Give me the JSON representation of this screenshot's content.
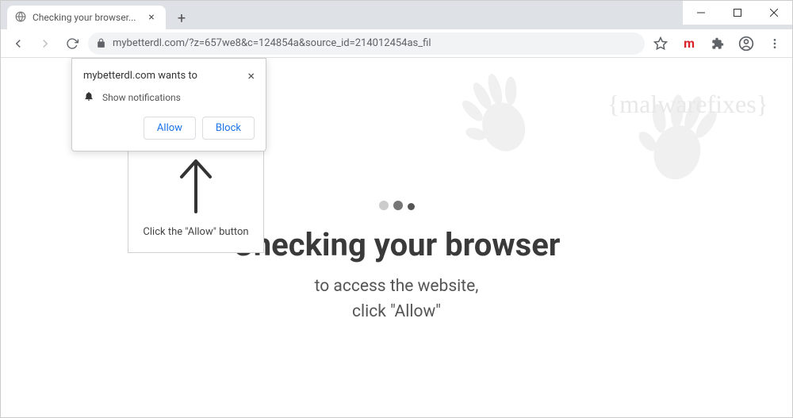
{
  "window": {
    "tab_title": "Checking your browser..."
  },
  "toolbar": {
    "url": "mybetterdl.com/?z=657we8&c=124854a&source_id=214012454as_fil"
  },
  "notification": {
    "domain_text": "mybetterdl.com wants to",
    "body_text": "Show notifications",
    "allow_label": "Allow",
    "block_label": "Block"
  },
  "allow_box": {
    "text": "Click the \"Allow\" button"
  },
  "main": {
    "title": "Checking your browser",
    "subtitle_line1": "to access the website,",
    "subtitle_line2": "click \"Allow\""
  },
  "watermark": {
    "text": "{malwarefixes}"
  }
}
